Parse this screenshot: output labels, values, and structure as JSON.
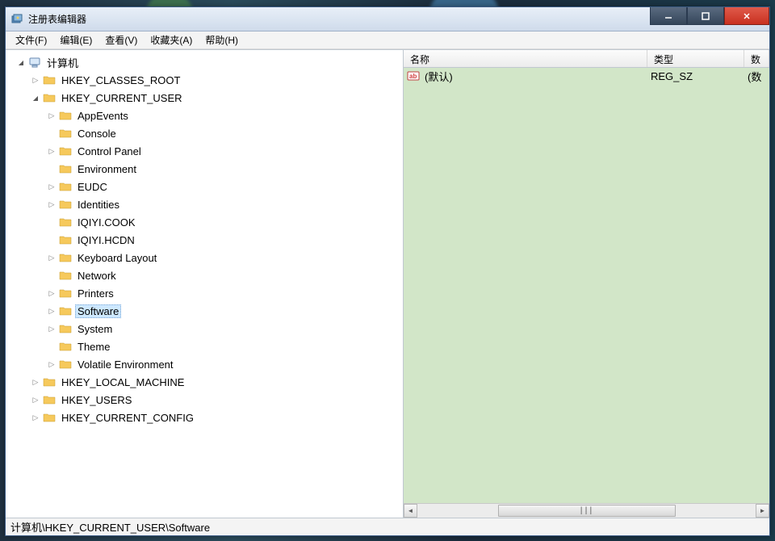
{
  "window": {
    "title": "注册表编辑器"
  },
  "menu": {
    "file": "文件(F)",
    "edit": "编辑(E)",
    "view": "查看(V)",
    "favorites": "收藏夹(A)",
    "help": "帮助(H)"
  },
  "tree": {
    "root": "计算机",
    "hkcr": "HKEY_CLASSES_ROOT",
    "hkcu": "HKEY_CURRENT_USER",
    "hkcu_children": {
      "appevents": "AppEvents",
      "console": "Console",
      "controlpanel": "Control Panel",
      "environment": "Environment",
      "eudc": "EUDC",
      "identities": "Identities",
      "iqiyicook": "IQIYI.COOK",
      "iqiyihcdn": "IQIYI.HCDN",
      "keyboard": "Keyboard Layout",
      "network": "Network",
      "printers": "Printers",
      "software": "Software",
      "system": "System",
      "theme": "Theme",
      "volatile": "Volatile Environment"
    },
    "hklm": "HKEY_LOCAL_MACHINE",
    "hku": "HKEY_USERS",
    "hkcc": "HKEY_CURRENT_CONFIG"
  },
  "list": {
    "header": {
      "name": "名称",
      "type": "类型",
      "data": "数"
    },
    "row0": {
      "name": "(默认)",
      "type": "REG_SZ",
      "data": "(数"
    }
  },
  "statusbar": {
    "path": "计算机\\HKEY_CURRENT_USER\\Software"
  }
}
